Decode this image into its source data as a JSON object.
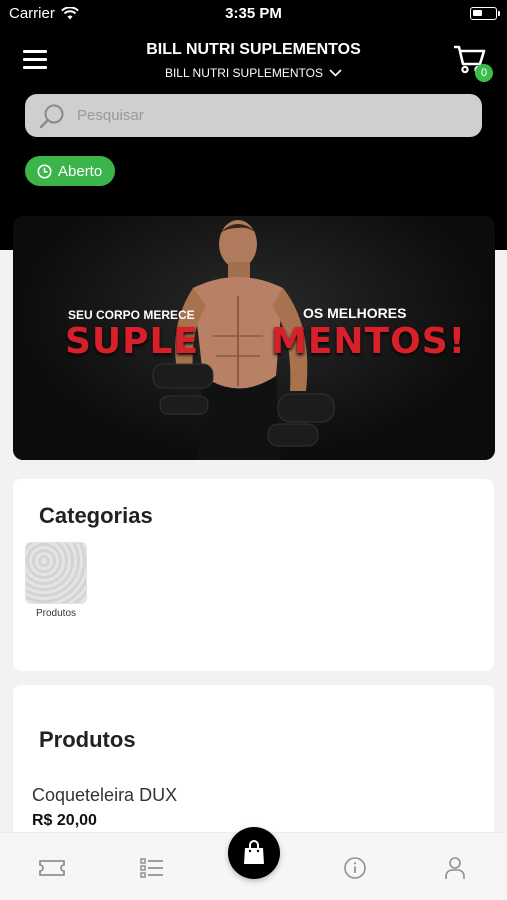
{
  "status_bar": {
    "carrier": "Carrier",
    "time": "3:35 PM"
  },
  "header": {
    "title": "BILL NUTRI SUPLEMENTOS",
    "store_selector": "BILL NUTRI SUPLEMENTOS",
    "cart_count": "0"
  },
  "search": {
    "placeholder": "Pesquisar"
  },
  "open_status": "Aberto",
  "banner": {
    "tagline_left": "SEU CORPO MERECE",
    "tagline_right": "OS MELHORES",
    "headline_left": "SUPLE",
    "headline_right": "MENTOS!"
  },
  "categories": {
    "title": "Categorias",
    "items": [
      {
        "label": "Produtos"
      }
    ]
  },
  "products": {
    "title": "Produtos",
    "items": [
      {
        "name": "Coqueteleira DUX",
        "price": "R$ 20,00"
      }
    ]
  },
  "colors": {
    "accent_green": "#3bb54a",
    "header_bg": "#000000",
    "headline_red": "#d8202a"
  },
  "tab_bar": {
    "icons": [
      "ticket-icon",
      "list-icon",
      "shopping-bag-icon",
      "info-icon",
      "user-icon"
    ]
  }
}
